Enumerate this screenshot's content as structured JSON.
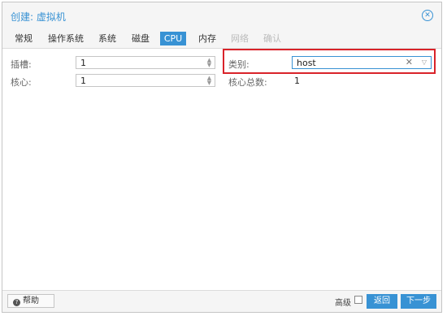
{
  "window": {
    "title": "创建: 虚拟机"
  },
  "tabs": [
    {
      "label": "常规"
    },
    {
      "label": "操作系统"
    },
    {
      "label": "系统"
    },
    {
      "label": "磁盘"
    },
    {
      "label": "CPU"
    },
    {
      "label": "内存"
    },
    {
      "label": "网络"
    },
    {
      "label": "确认"
    }
  ],
  "active_tab": "CPU",
  "form": {
    "sockets": {
      "label": "插槽:",
      "value": "1"
    },
    "cores": {
      "label": "核心:",
      "value": "1"
    },
    "type": {
      "label": "类别:",
      "value": "host"
    },
    "total_cores": {
      "label": "核心总数:",
      "value": "1"
    }
  },
  "footer": {
    "help_label": "帮助",
    "advanced_label": "高级",
    "back_label": "返回",
    "next_label": "下一步"
  },
  "colors": {
    "accent": "#3892d4",
    "highlight": "#d9232a"
  }
}
